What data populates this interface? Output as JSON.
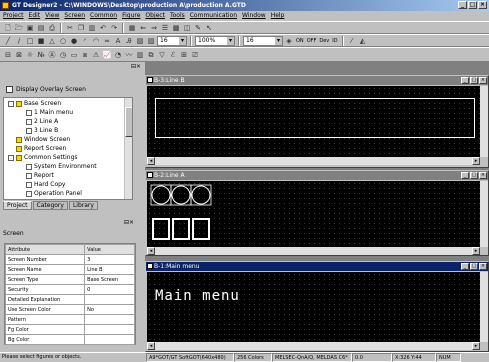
{
  "app": {
    "title": "GT Designer2 - C:\\WINDOWS\\Desktop\\production A\\production A.GTD"
  },
  "menu": [
    "Project",
    "Edit",
    "View",
    "Screen",
    "Common",
    "Figure",
    "Object",
    "Tools",
    "Communication",
    "Window",
    "Help"
  ],
  "toolbar": {
    "font_size": "16",
    "zoom": "100%",
    "line_size": "16",
    "on_label": "ON",
    "off_label": "OFF",
    "dev_label": "Dev",
    "id_label": "ID"
  },
  "project_pane": {
    "display_overlay_label": "Display Overlay Screen",
    "tree": [
      {
        "label": "Base Screen",
        "level": 1,
        "type": "folder"
      },
      {
        "label": "1 Main menu",
        "level": 2,
        "type": "screen"
      },
      {
        "label": "2 Line A",
        "level": 2,
        "type": "screen"
      },
      {
        "label": "3 Line B",
        "level": 2,
        "type": "screen"
      },
      {
        "label": "Window Screen",
        "level": 1,
        "type": "folder"
      },
      {
        "label": "Report Screen",
        "level": 1,
        "type": "folder"
      },
      {
        "label": "Common Settings",
        "level": 1,
        "type": "folder"
      },
      {
        "label": "System Environment",
        "level": 2,
        "type": "setting"
      },
      {
        "label": "Report",
        "level": 2,
        "type": "setting"
      },
      {
        "label": "Hard Copy",
        "level": 2,
        "type": "setting"
      },
      {
        "label": "Operation Panel",
        "level": 2,
        "type": "setting"
      }
    ],
    "tabs": [
      "Project",
      "Category",
      "Library"
    ]
  },
  "property_pane": {
    "label": "Screen",
    "columns": [
      "Attribute",
      "Value"
    ],
    "rows": [
      {
        "attr": "Screen Number",
        "value": "3"
      },
      {
        "attr": "Screen Name",
        "value": "Line B"
      },
      {
        "attr": "Screen Type",
        "value": "Base Screen"
      },
      {
        "attr": "Security",
        "value": "0"
      },
      {
        "attr": "Detailed Explanation",
        "value": ""
      },
      {
        "attr": "Use Screen Color",
        "value": "No"
      },
      {
        "attr": "Pattern",
        "value": ""
      },
      {
        "attr": "Fg Color",
        "value": ""
      },
      {
        "attr": "Bg Color",
        "value": ""
      }
    ]
  },
  "windows": [
    {
      "title": "B-3:Line B",
      "active": false
    },
    {
      "title": "B-2:Line A",
      "active": false
    },
    {
      "title": "B-1:Main menu",
      "active": true,
      "canvas_text": "Main menu"
    }
  ],
  "status": {
    "hint": "Please select figures or objects.",
    "model": "A9*GOT/GT SoftGOT(640x480)",
    "colors": "256 Colors",
    "plc": "MELSEC-QnA/Q, MELDAS C6*",
    "unit": "0.0",
    "coords": "X:326 Y:44",
    "num": "NUM"
  },
  "colors": {
    "title_active": "#0a246a",
    "canvas_bg": "#000000",
    "canvas_fg": "#ffffff"
  }
}
